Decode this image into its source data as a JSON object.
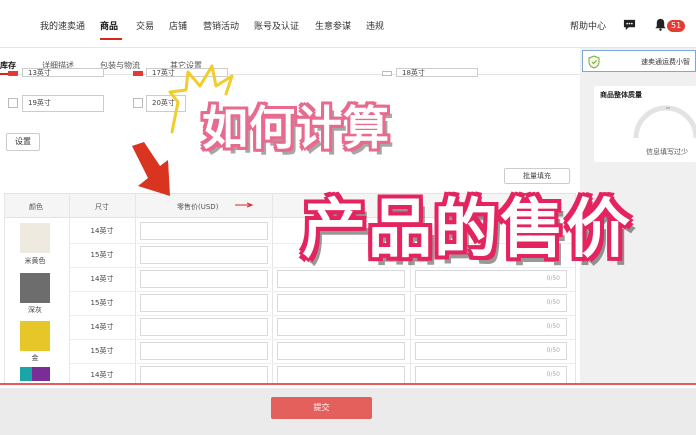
{
  "nav": {
    "items": [
      "我的速卖通",
      "商品",
      "交易",
      "店铺",
      "营销活动",
      "账号及认证",
      "生意参谋",
      "违规"
    ],
    "active": "商品",
    "help": "帮助中心",
    "badge": "51"
  },
  "subtabs": [
    "库存",
    "详细描述",
    "包装与物流",
    "其它设置"
  ],
  "size_inputs": {
    "row1": [
      "13英寸",
      "17英寸",
      "18英寸"
    ],
    "row2": [
      "19英寸",
      "20英寸"
    ]
  },
  "buttons": {
    "settings": "设置",
    "batch_fill": "批量填充",
    "submit": "提交"
  },
  "table": {
    "headers": [
      "颜色",
      "尺寸",
      "零售价(USD)"
    ],
    "colors": [
      {
        "name": "米黄色",
        "hex": "#eeeadf"
      },
      {
        "name": "深灰",
        "hex": "#6d6d6d"
      },
      {
        "name": "金",
        "hex": "#e7c62a"
      }
    ],
    "sizes": [
      "14英寸",
      "15英寸",
      "14英寸",
      "15英寸",
      "14英寸",
      "15英寸",
      "14英寸"
    ],
    "counters": [
      "0/50",
      "0/50",
      "0/50",
      "0/50",
      "0/50",
      "0/50"
    ]
  },
  "right_panel": {
    "banner": "速卖通运费小智",
    "quality_title": "商品整体质量",
    "quality_note": "信息填写过少"
  },
  "overlay": {
    "line1": "如何计算",
    "line2": "产品的售价"
  },
  "colors": {
    "accent": "#d8261f",
    "overlay_pink": "#e86a8e",
    "overlay_red": "#e4245f",
    "submit": "#e4605c"
  }
}
